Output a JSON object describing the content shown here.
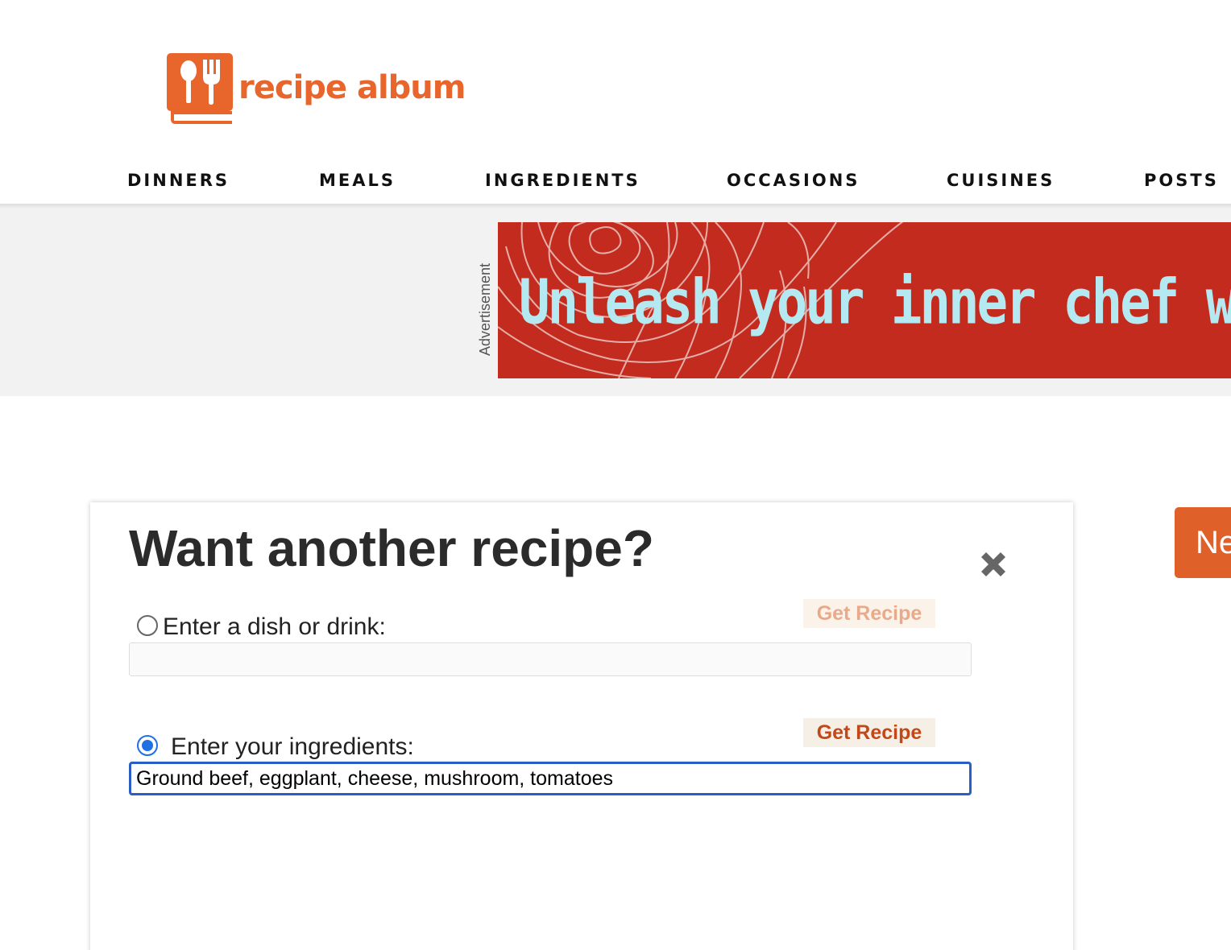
{
  "brand": {
    "name": "recipe album",
    "color": "#e8652c"
  },
  "nav": {
    "items": [
      {
        "label": "DINNERS"
      },
      {
        "label": "MEALS"
      },
      {
        "label": "INGREDIENTS"
      },
      {
        "label": "OCCASIONS"
      },
      {
        "label": "CUISINES"
      },
      {
        "label": "POSTS"
      }
    ]
  },
  "ad": {
    "label": "Advertisement",
    "headline": "Unleash your inner chef with pe"
  },
  "modal": {
    "title": "Want another recipe?",
    "close_icon": "close-icon",
    "dish_option": {
      "label": "Enter a dish or drink:",
      "selected": false,
      "value": "",
      "button_label": "Get Recipe"
    },
    "ingredients_option": {
      "label": "Enter your ingredients:",
      "selected": true,
      "value": "Ground beef, eggplant, cheese, mushroom, tomatoes",
      "button_label": "Get Recipe"
    }
  },
  "side_button": {
    "label": "Ne"
  }
}
